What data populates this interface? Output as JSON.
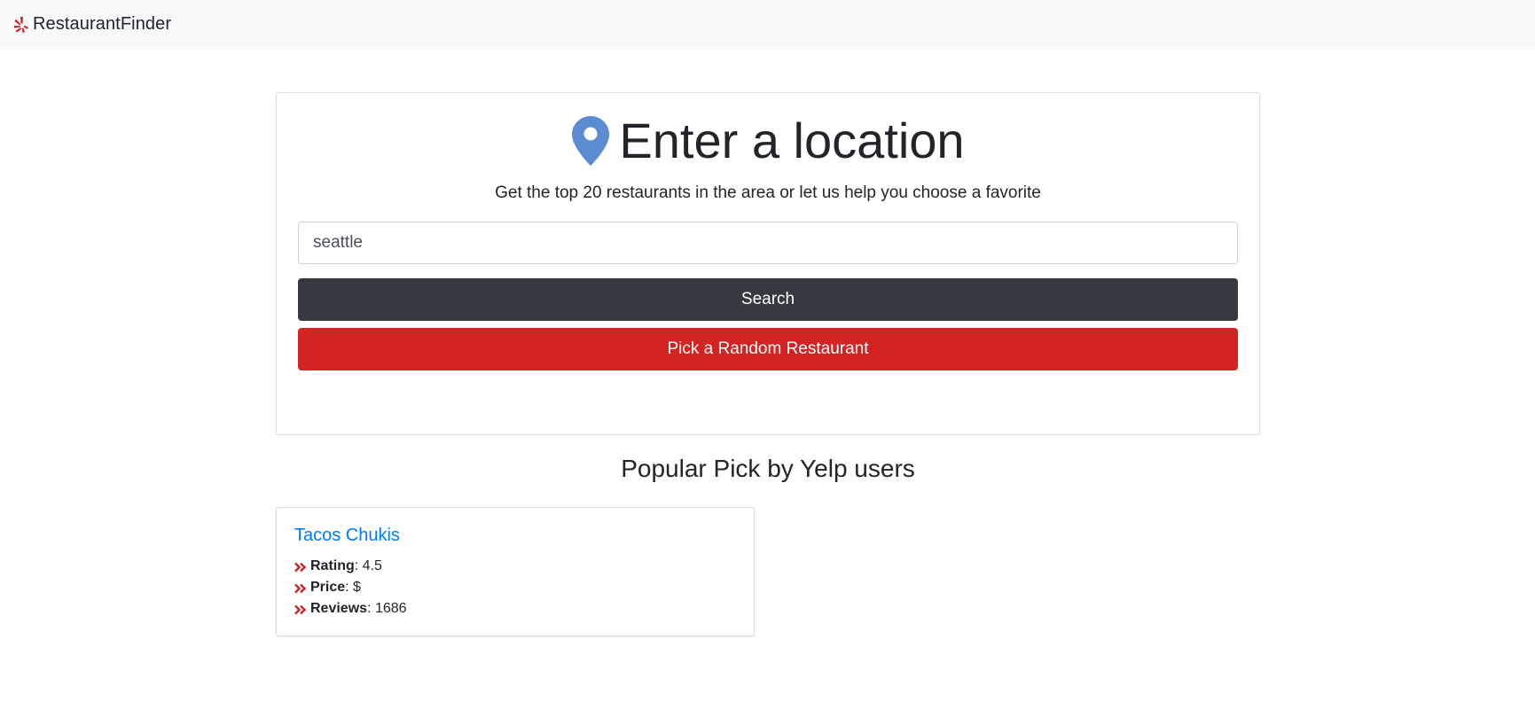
{
  "navbar": {
    "brand_icon": "yelp-burst-icon",
    "brand_name": "RestaurantFinder"
  },
  "search_panel": {
    "pin_icon": "map-marker-icon",
    "title": "Enter a location",
    "subtitle": "Get the top 20 restaurants in the area or let us help you choose a favorite",
    "location_value": "seattle",
    "search_label": "Search",
    "random_label": "Pick a Random Restaurant"
  },
  "popular": {
    "heading": "Popular Pick by Yelp users",
    "restaurant": {
      "name": "Tacos Chukis",
      "details": [
        {
          "label": "Rating",
          "value": ": 4.5"
        },
        {
          "label": "Price",
          "value": ": $"
        },
        {
          "label": "Reviews",
          "value": ": 1686"
        }
      ]
    }
  },
  "colors": {
    "accent_red": "#d32323",
    "dark_button": "#343a40",
    "link_blue": "#007bff",
    "pin_blue": "#5b8bd0"
  }
}
